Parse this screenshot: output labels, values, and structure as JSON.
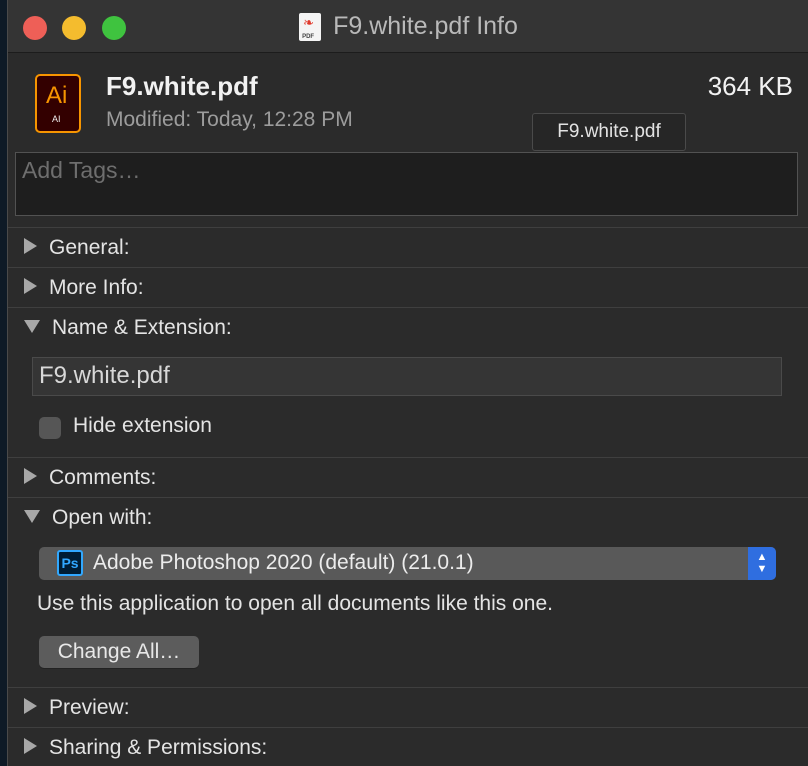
{
  "window": {
    "title": "F9.white.pdf Info",
    "title_icon": "pdf-file-icon",
    "title_icon_label": "PDF"
  },
  "file": {
    "name": "F9.white.pdf",
    "modified": "Modified: Today, 12:28 PM",
    "size": "364 KB",
    "icon": "illustrator-file-icon",
    "icon_label_big": "Ai",
    "icon_label_small": "AI"
  },
  "tooltip": {
    "text": "F9.white.pdf"
  },
  "tags": {
    "placeholder": "Add Tags…"
  },
  "sections": {
    "general": "General:",
    "more_info": "More Info:",
    "name_extension": "Name & Extension:",
    "comments": "Comments:",
    "open_with": "Open with:",
    "preview": "Preview:",
    "sharing": "Sharing & Permissions:"
  },
  "name_extension": {
    "field_value": "F9.white.pdf",
    "hide_extension_label": "Hide extension",
    "hide_extension_checked": false
  },
  "open_with": {
    "app_icon": "photoshop-icon",
    "app_icon_label": "Ps",
    "selected_app": "Adobe Photoshop 2020 (default) (21.0.1)",
    "help_text": "Use this application to open all documents like this one.",
    "change_all_label": "Change All…"
  },
  "colors": {
    "accent": "#2f6ee0",
    "close": "#ee5f57",
    "minimize": "#f4bc2e",
    "zoom": "#3fc33f"
  }
}
